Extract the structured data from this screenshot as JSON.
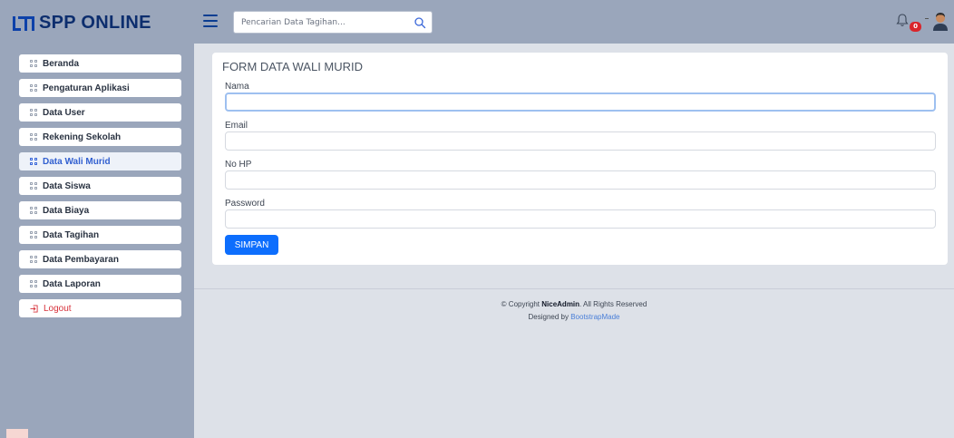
{
  "brand": {
    "name": "SPP ONLINE"
  },
  "header": {
    "search_placeholder": "Pencarian Data Tagihan...",
    "notification_count": "0"
  },
  "sidebar": {
    "items": [
      {
        "label": "Beranda",
        "icon": "grid-icon",
        "active": false
      },
      {
        "label": "Pengaturan Aplikasi",
        "icon": "grid-icon",
        "active": false
      },
      {
        "label": "Data User",
        "icon": "grid-icon",
        "active": false
      },
      {
        "label": "Rekening Sekolah",
        "icon": "grid-icon",
        "active": false
      },
      {
        "label": "Data Wali Murid",
        "icon": "grid-icon",
        "active": true
      },
      {
        "label": "Data Siswa",
        "icon": "grid-icon",
        "active": false
      },
      {
        "label": "Data Biaya",
        "icon": "grid-icon",
        "active": false
      },
      {
        "label": "Data Tagihan",
        "icon": "grid-icon",
        "active": false
      },
      {
        "label": "Data Pembayaran",
        "icon": "grid-icon",
        "active": false
      },
      {
        "label": "Data Laporan",
        "icon": "grid-icon",
        "active": false
      }
    ],
    "logout": {
      "label": "Logout",
      "icon": "logout-icon"
    }
  },
  "form": {
    "title": "FORM DATA WALI MURID",
    "fields": [
      {
        "label": "Nama",
        "value": ""
      },
      {
        "label": "Email",
        "value": ""
      },
      {
        "label": "No HP",
        "value": ""
      },
      {
        "label": "Password",
        "value": ""
      }
    ],
    "submit_label": "SIMPAN"
  },
  "footer": {
    "copyright_prefix": "© Copyright ",
    "copyright_brand": "NiceAdmin",
    "copyright_suffix": ". All Rights Reserved",
    "designed_prefix": "Designed by ",
    "designed_link": "BootstrapMade"
  },
  "colors": {
    "accent": "#0d6efd",
    "sidebar_bg": "#9aa6bb",
    "badge": "#d9252b",
    "logout": "#d7323b"
  }
}
